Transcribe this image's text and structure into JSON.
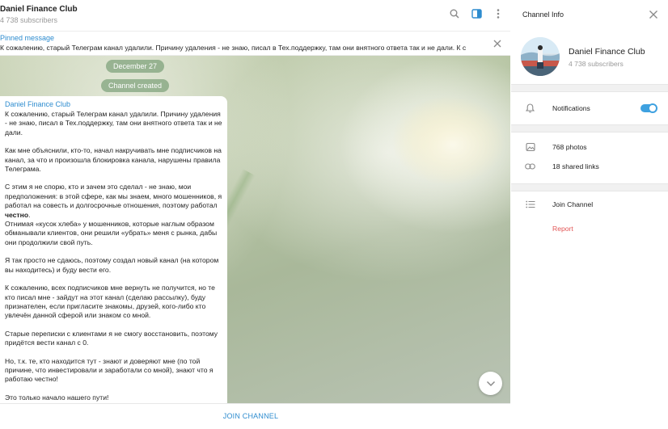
{
  "chat": {
    "title": "Daniel Finance Club",
    "subscribers": "4 738 subscribers",
    "icons": [
      "search-icon",
      "sidebar-toggle-icon",
      "more-vertical-icon"
    ]
  },
  "pinned": {
    "title": "Pinned message",
    "text": "К сожалению, старый Телеграм канал удалили. Причину удаления - не знаю, писал в Тех.поддержку, там они внятного ответа так и не дали.  К с"
  },
  "service": {
    "date": "December 27",
    "created": "Channel created"
  },
  "message": {
    "author": "Daniel Finance Club",
    "p1": "К сожалению, старый Телеграм канал удалили. Причину удаления - не знаю, писал в Тех.поддержку, там они внятного ответа так и не дали.",
    "p2": "Как мне объяснили, кто-то, начал накручивать мне подписчиков на канал, за что и произошла блокировка канала, нарушены правила Телеграма.",
    "p3a": "С этим я не спорю, кто и зачем это сделал - не знаю, мои предположения: в этой сфере, как мы знаем, много мошенников, я работал на совесть и долгосрочные отношения, поэтому работал ",
    "p3b": "честно",
    "p3c": ".",
    "p3d": "Отнимая «кусок хлеба» у мошенников, которые наглым образом обманывали клиентов, они решили «убрать» меня с рынка, дабы они продолжили свой путь.",
    "p4": "Я так просто не сдаюсь, поэтому создал новый канал (на котором вы находитесь) и буду вести его.",
    "p5": "К сожалению, всех подписчиков мне вернуть не получится, но те кто писал мне - зайдут на этот канал (сделаю рассылку), буду признателен, если пригласите знакомы, друзей, кого-либо кто увлечён данной сферой или знаком со мной.",
    "p6": "Старые переписки с клиентами я не смогу восстановить, поэтому придётся вести канал с 0.",
    "p7": "Но, т.к. те, кто находится тут - знают и доверяют мне (по той причине, что инвестировали и заработали со мной), знают что я работаю честно!",
    "p8": "Это только начало нашего пути!"
  },
  "bottom": {
    "join_label": "JOIN CHANNEL"
  },
  "info": {
    "header": "Channel Info",
    "name": "Daniel Finance Club",
    "subscribers": "4 738 subscribers",
    "notifications_label": "Notifications",
    "notifications_on": true,
    "photos_label": "768 photos",
    "links_label": "18 shared links",
    "join_label": "Join Channel",
    "report_label": "Report"
  },
  "colors": {
    "accent": "#2e8ccf",
    "danger": "#e25757",
    "toggle": "#3ea1e0"
  }
}
